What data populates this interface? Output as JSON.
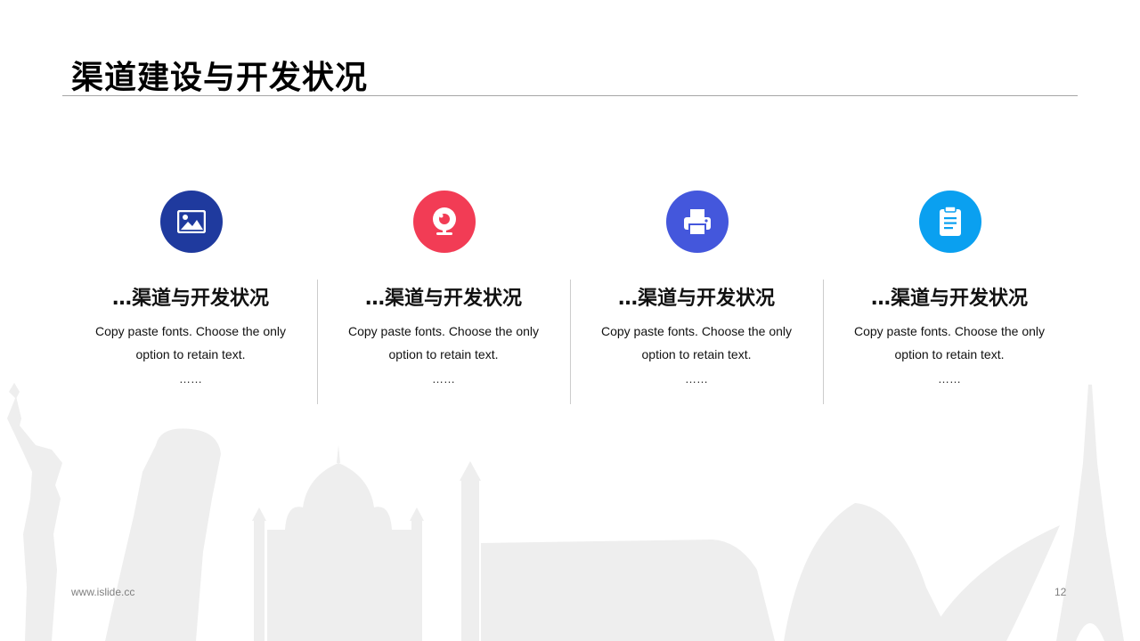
{
  "slide": {
    "title": "渠道建设与开发状况",
    "footer_url": "www.islide.cc",
    "page_number": "12"
  },
  "columns": [
    {
      "icon": "image-icon",
      "color": "#1f3a9e",
      "title": "…渠道与开发状况",
      "body_line1": "Copy paste fonts. Choose the only",
      "body_line2": "option to retain text.",
      "ellipsis": "……"
    },
    {
      "icon": "webcam-icon",
      "color": "#f23c55",
      "title": "…渠道与开发状况",
      "body_line1": "Copy paste fonts. Choose the only",
      "body_line2": "option to retain text.",
      "ellipsis": "……"
    },
    {
      "icon": "printer-icon",
      "color": "#4457dc",
      "title": "…渠道与开发状况",
      "body_line1": "Copy paste fonts. Choose the only",
      "body_line2": "option to retain text.",
      "ellipsis": "……"
    },
    {
      "icon": "clipboard-icon",
      "color": "#0aa0f0",
      "title": "…渠道与开发状况",
      "body_line1": "Copy paste fonts. Choose the only",
      "body_line2": "option to retain text.",
      "ellipsis": "……"
    }
  ]
}
